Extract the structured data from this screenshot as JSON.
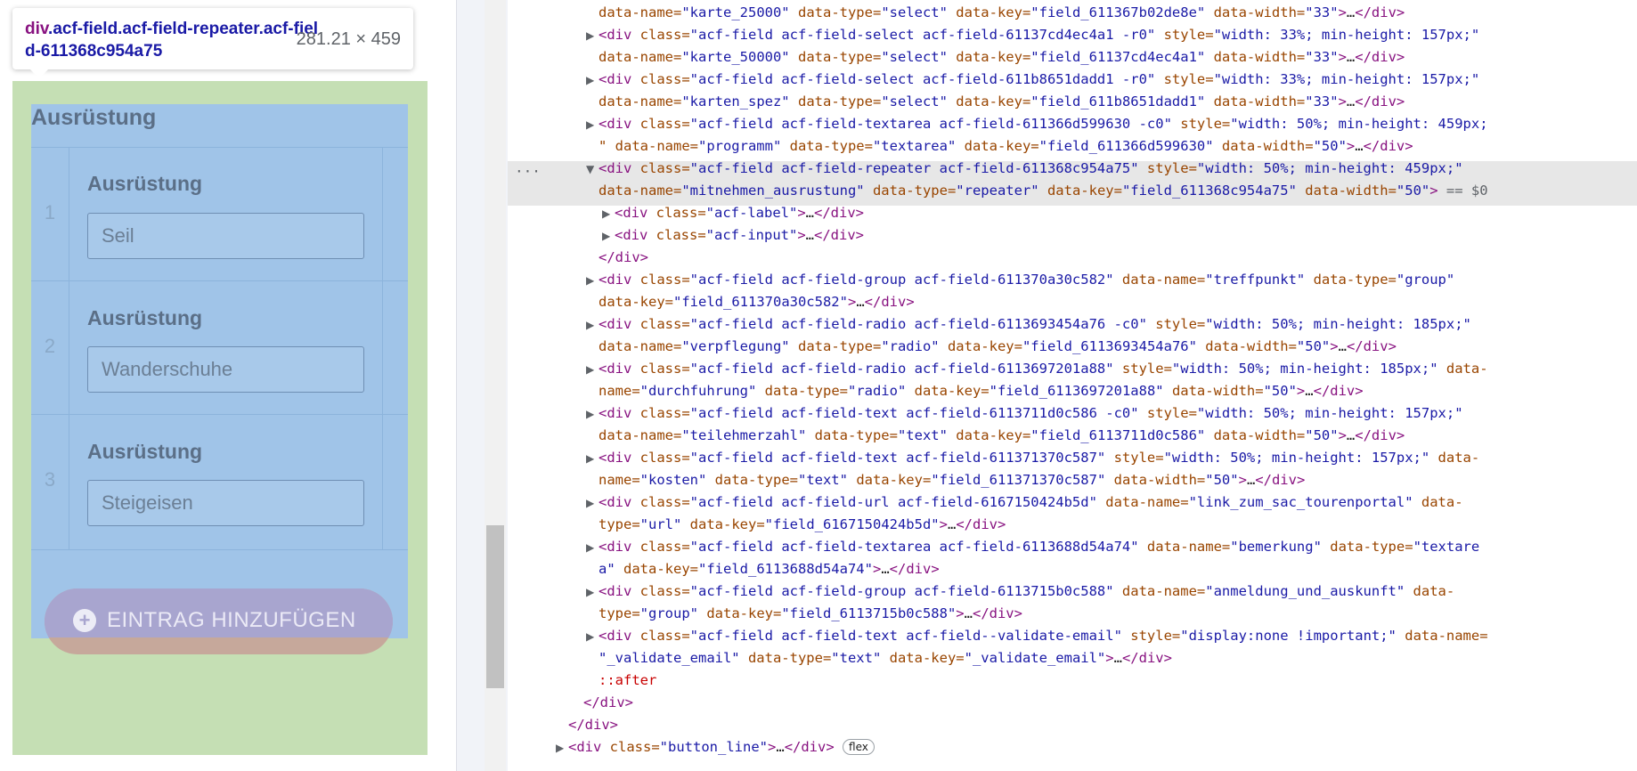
{
  "tooltip": {
    "element": "div",
    "classes": ".acf-field.acf-field-repeater.acf-field-611368c954a75",
    "size": "281.21 × 459"
  },
  "section_title": "Ausrüstung",
  "repeater_rows": [
    {
      "num": "1",
      "label": "Ausrüstung",
      "value": "Seil"
    },
    {
      "num": "2",
      "label": "Ausrüstung",
      "value": "Wanderschuhe"
    },
    {
      "num": "3",
      "label": "Ausrüstung",
      "value": "Steigeisen"
    }
  ],
  "add_button_label": "EINTRAG HINZUFÜGEN",
  "devtools": {
    "dots": "···",
    "lines": [
      {
        "t1": "data-name=",
        "v1": "\"karte_25000\"",
        "t2": " data-type=",
        "v2": "\"select\"",
        "t3": " data-key=",
        "v3": "\"field_611367b02de8e\"",
        "t4": " data-width=",
        "v4": "\"33\"",
        "end": ">…</div>"
      },
      {
        "open": "<div ",
        "a": "class=",
        "v": "\"acf-field acf-field-select acf-field-61137cd4ec4a1 -r0\"",
        "a2": " style=",
        "v2": "\"width: 33%; min-height: 157px;\""
      },
      {
        "t1": "data-name=",
        "v1": "\"karte_50000\"",
        "t2": " data-type=",
        "v2": "\"select\"",
        "t3": " data-key=",
        "v3": "\"field_61137cd4ec4a1\"",
        "t4": " data-width=",
        "v4": "\"33\"",
        "end": ">…</div>"
      },
      {
        "open": "<div ",
        "a": "class=",
        "v": "\"acf-field acf-field-select acf-field-611b8651dadd1 -r0\"",
        "a2": " style=",
        "v2": "\"width: 33%; min-height: 157px;\""
      },
      {
        "t1": "data-name=",
        "v1": "\"karten_spez\"",
        "t2": " data-type=",
        "v2": "\"select\"",
        "t3": " data-key=",
        "v3": "\"field_611b8651dadd1\"",
        "t4": " data-width=",
        "v4": "\"33\"",
        "end": ">…</div>"
      },
      {
        "open": "<div ",
        "a": "class=",
        "v": "\"acf-field acf-field-textarea acf-field-611366d599630 -c0\"",
        "a2": " style=",
        "v2": "\"width: 50%; min-height: 459px;"
      },
      {
        "t1": "\" data-name=",
        "v1": "\"programm\"",
        "t2": " data-type=",
        "v2": "\"textarea\"",
        "t3": " data-key=",
        "v3": "\"field_611366d599630\"",
        "t4": " data-width=",
        "v4": "\"50\"",
        "end": ">…</div>"
      },
      {
        "open": "<div ",
        "a": "class=",
        "v": "\"acf-field acf-field-repeater acf-field-611368c954a75\"",
        "a2": " style=",
        "v2": "\"width: 50%; min-height: 459px;\""
      },
      {
        "t1": "data-name=",
        "v1": "\"mitnehmen_ausrustung\"",
        "t2": " data-type=",
        "v2": "\"repeater\"",
        "t3": " data-key=",
        "v3": "\"field_611368c954a75\"",
        "t4": " data-width=",
        "v4": "\"50\"",
        "end": "> == $0"
      },
      {
        "open": "<div ",
        "a": "class=",
        "v": "\"acf-label\"",
        "end": ">…</div>"
      },
      {
        "open": "<div ",
        "a": "class=",
        "v": "\"acf-input\"",
        "end": ">…</div>"
      },
      {
        "close": "</div>"
      },
      {
        "open": "<div ",
        "a": "class=",
        "v": "\"acf-field acf-field-group acf-field-611370a30c582\"",
        "a2": " data-name=",
        "v2": "\"treffpunkt\"",
        "a3": " data-type=",
        "v3": "\"group\""
      },
      {
        "t1": "data-key=",
        "v1": "\"field_611370a30c582\"",
        "end": ">…</div>"
      },
      {
        "open": "<div ",
        "a": "class=",
        "v": "\"acf-field acf-field-radio acf-field-6113693454a76 -c0\"",
        "a2": " style=",
        "v2": "\"width: 50%; min-height: 185px;\""
      },
      {
        "t1": "data-name=",
        "v1": "\"verpflegung\"",
        "t2": " data-type=",
        "v2": "\"radio\"",
        "t3": " data-key=",
        "v3": "\"field_6113693454a76\"",
        "t4": " data-width=",
        "v4": "\"50\"",
        "end": ">…</div>"
      },
      {
        "open": "<div ",
        "a": "class=",
        "v": "\"acf-field acf-field-radio acf-field-6113697201a88\"",
        "a2": " style=",
        "v2": "\"width: 50%; min-height: 185px;\"",
        "a3": " data-"
      },
      {
        "t1": "name=",
        "v1": "\"durchfuhrung\"",
        "t2": " data-type=",
        "v2": "\"radio\"",
        "t3": " data-key=",
        "v3": "\"field_6113697201a88\"",
        "t4": " data-width=",
        "v4": "\"50\"",
        "end": ">…</div>"
      },
      {
        "open": "<div ",
        "a": "class=",
        "v": "\"acf-field acf-field-text acf-field-6113711d0c586 -c0\"",
        "a2": " style=",
        "v2": "\"width: 50%; min-height: 157px;\""
      },
      {
        "t1": "data-name=",
        "v1": "\"teilehmerzahl\"",
        "t2": " data-type=",
        "v2": "\"text\"",
        "t3": " data-key=",
        "v3": "\"field_6113711d0c586\"",
        "t4": " data-width=",
        "v4": "\"50\"",
        "end": ">…</div>"
      },
      {
        "open": "<div ",
        "a": "class=",
        "v": "\"acf-field acf-field-text acf-field-611371370c587\"",
        "a2": " style=",
        "v2": "\"width: 50%; min-height: 157px;\"",
        "a3": " data-"
      },
      {
        "t1": "name=",
        "v1": "\"kosten\"",
        "t2": " data-type=",
        "v2": "\"text\"",
        "t3": " data-key=",
        "v3": "\"field_611371370c587\"",
        "t4": " data-width=",
        "v4": "\"50\"",
        "end": ">…</div>"
      },
      {
        "open": "<div ",
        "a": "class=",
        "v": "\"acf-field acf-field-url acf-field-6167150424b5d\"",
        "a2": " data-name=",
        "v2": "\"link_zum_sac_tourenportal\"",
        "a3": " data-"
      },
      {
        "t1": "type=",
        "v1": "\"url\"",
        "t2": " data-key=",
        "v2": "\"field_6167150424b5d\"",
        "end": ">…</div>"
      },
      {
        "open": "<div ",
        "a": "class=",
        "v": "\"acf-field acf-field-textarea acf-field-6113688d54a74\"",
        "a2": " data-name=",
        "v2": "\"bemerkung\"",
        "a3": " data-type=",
        "v3": "\"textare"
      },
      {
        "t1": "",
        "v1": "a\"",
        "t2": " data-key=",
        "v2": "\"field_6113688d54a74\"",
        "end": ">…</div>"
      },
      {
        "open": "<div ",
        "a": "class=",
        "v": "\"acf-field acf-field-group acf-field-6113715b0c588\"",
        "a2": " data-name=",
        "v2": "\"anmeldung_und_auskunft\"",
        "a3": " data-"
      },
      {
        "t1": "type=",
        "v1": "\"group\"",
        "t2": " data-key=",
        "v2": "\"field_6113715b0c588\"",
        "end": ">…</div>"
      },
      {
        "open": "<div ",
        "a": "class=",
        "v": "\"acf-field acf-field-text acf-field--validate-email\"",
        "a2": " style=",
        "v2": "\"display:none !important;\"",
        "a3": " data-name="
      },
      {
        "t1": "",
        "v1": "\"_validate_email\"",
        "t2": " data-type=",
        "v2": "\"text\"",
        "t3": " data-key=",
        "v3": "\"_validate_email\"",
        "end": ">…</div>"
      },
      {
        "pseudo": "::after"
      },
      {
        "close": "</div>"
      },
      {
        "close": "</div>"
      },
      {
        "open": "<div ",
        "a": "class=",
        "v": "\"button_line\"",
        "end": ">…</div>",
        "badge": "flex"
      }
    ]
  }
}
